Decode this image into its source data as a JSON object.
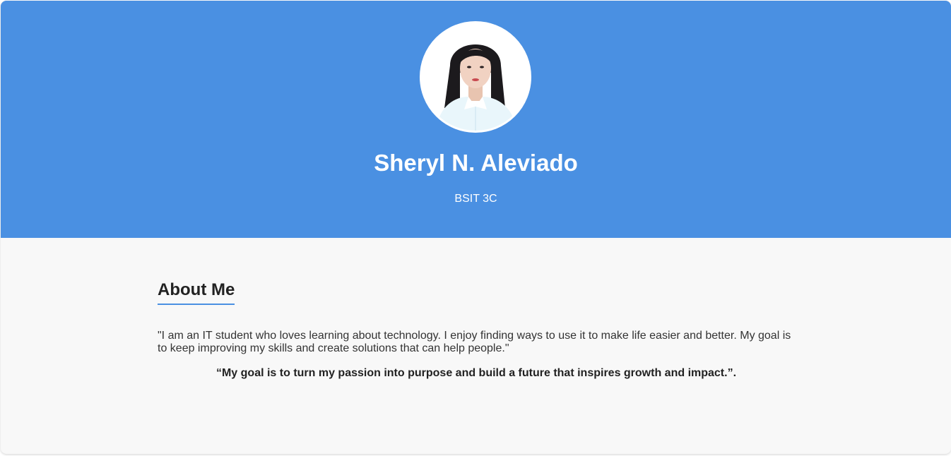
{
  "profile": {
    "name": "Sheryl N. Aleviado",
    "course": "BSIT 3C"
  },
  "about": {
    "title": "About Me",
    "text": "\"I am an IT student who loves learning about technology. I enjoy finding ways to use it to make life easier and better. My goal is to keep improving my skills and create solutions that can help people.\"",
    "quote": "“My goal is to turn my passion into purpose and build a future that inspires growth and impact.”."
  },
  "colors": {
    "accent": "#4a90e2",
    "background": "#f8f8f8",
    "text": "#333333"
  }
}
